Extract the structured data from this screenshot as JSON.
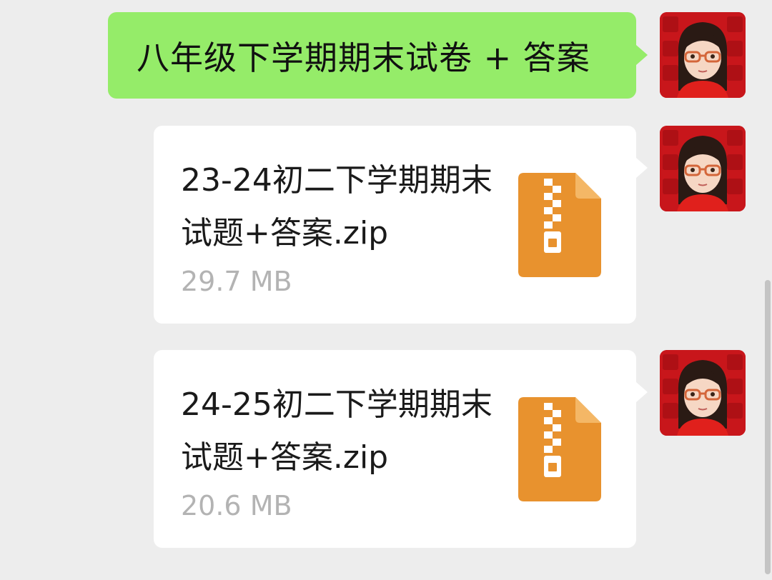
{
  "messages": [
    {
      "type": "text",
      "text": "八年级下学期期末试卷 + 答案"
    },
    {
      "type": "file",
      "file_name": "23-24初二下学期期末试题+答案.zip",
      "file_size": "29.7 MB",
      "icon": "zip-file-icon"
    },
    {
      "type": "file",
      "file_name": "24-25初二下学期期末试题+答案.zip",
      "file_size": "20.6 MB",
      "icon": "zip-file-icon"
    }
  ],
  "colors": {
    "background": "#ededed",
    "sent_bubble": "#95ec69",
    "file_bubble": "#ffffff",
    "zip_icon": "#e8922e",
    "avatar_bg": "#c8161b"
  }
}
